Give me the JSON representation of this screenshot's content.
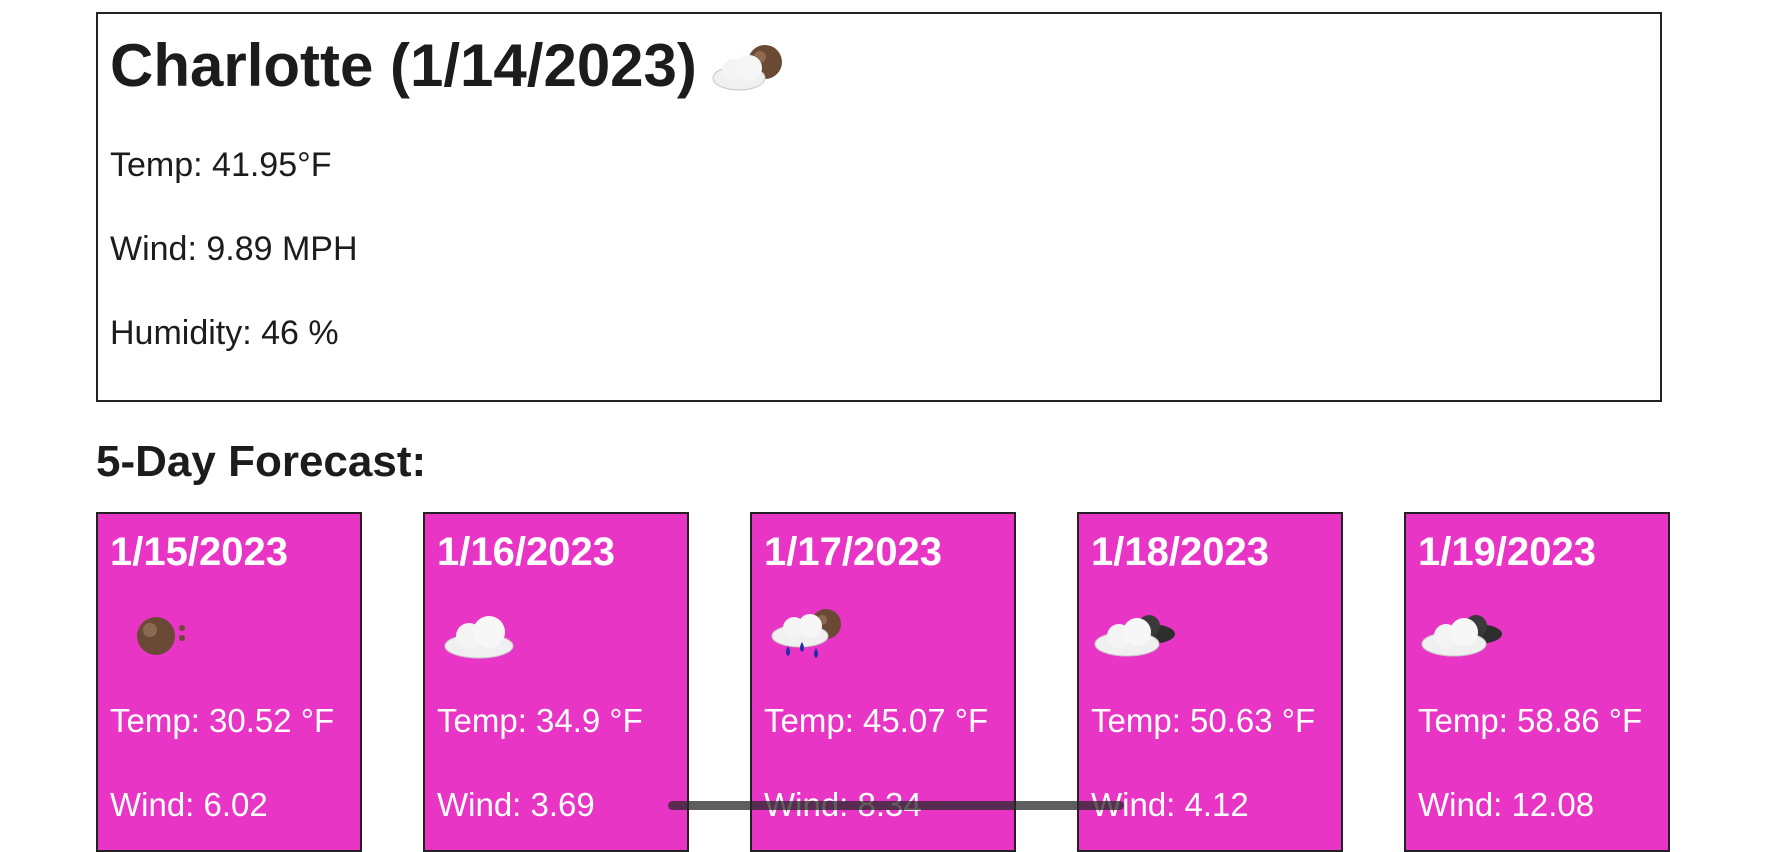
{
  "current": {
    "title": "Charlotte (1/14/2023)",
    "icon": "partly-cloudy-night-icon",
    "temp": "Temp: 41.95°F",
    "wind": "Wind: 9.89 MPH",
    "humidity": "Humidity: 46 %"
  },
  "forecast": {
    "heading": "5-Day Forecast:",
    "card_color": "#e835c5",
    "days": [
      {
        "date": "1/15/2023",
        "icon": "moon-icon",
        "temp": "Temp: 30.52 °F",
        "wind": "Wind: 6.02"
      },
      {
        "date": "1/16/2023",
        "icon": "cloud-icon",
        "temp": "Temp: 34.9 °F",
        "wind": "Wind: 3.69"
      },
      {
        "date": "1/17/2023",
        "icon": "rain-cloud-night-icon",
        "temp": "Temp: 45.07 °F",
        "wind": "Wind: 8.34"
      },
      {
        "date": "1/18/2023",
        "icon": "broken-clouds-icon",
        "temp": "Temp: 50.63 °F",
        "wind": "Wind: 4.12"
      },
      {
        "date": "1/19/2023",
        "icon": "broken-clouds-icon",
        "temp": "Temp: 58.86 °F",
        "wind": "Wind: 12.08"
      }
    ]
  }
}
